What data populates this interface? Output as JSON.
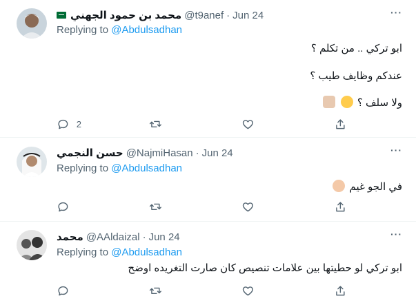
{
  "tweets": [
    {
      "name": "محمد بن حمود الجهني",
      "handle": "@t9anef",
      "dot": "·",
      "date": "Jun 24",
      "replying_prefix": "Replying to ",
      "replying_to": "@Abdulsadhan",
      "lines": [
        "ابو تركي .. من تكلم ؟",
        "عندكم وظايف طيب ؟",
        "ولا سلف ؟"
      ],
      "reply_count": "2",
      "more": "···",
      "icons": {
        "avatar": "user-photo",
        "badge": "saudi-flag-icon",
        "emoji": [
          "grinning-face-emoji",
          "thumbs-up-emoji"
        ]
      }
    },
    {
      "name": "حسن النجمي",
      "handle": "@NajmiHasan",
      "dot": "·",
      "date": "Jun 24",
      "replying_prefix": "Replying to ",
      "replying_to": "@Abdulsadhan",
      "lines": [
        "في الجو غيم"
      ],
      "reply_count": "",
      "more": "···",
      "icons": {
        "avatar": "user-photo",
        "emoji": [
          "person-shrugging-emoji"
        ]
      }
    },
    {
      "name": "محمد",
      "handle": "@AAldaizal",
      "dot": "·",
      "date": "Jun 24",
      "replying_prefix": "Replying to ",
      "replying_to": "@Abdulsadhan",
      "lines": [
        "ابو تركي لو حطيتها بين علامات تنصيص كان صارت التغريده اوضح"
      ],
      "reply_count": "",
      "more": "···",
      "icons": {
        "avatar": "user-photo"
      }
    }
  ],
  "colors": {
    "link": "#1d9bf0",
    "secondary": "#536471",
    "text": "#0f1419",
    "divider": "#eff3f4"
  },
  "action_icons": [
    "reply-icon",
    "retweet-icon",
    "like-icon",
    "share-icon"
  ]
}
